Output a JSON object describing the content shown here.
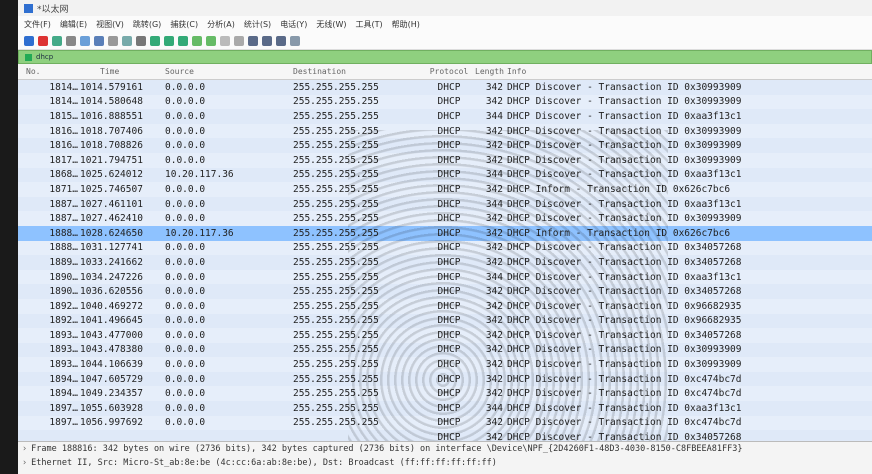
{
  "window": {
    "title": "*以太网"
  },
  "menu": [
    "文件(F)",
    "编辑(E)",
    "视图(V)",
    "跳转(G)",
    "捕获(C)",
    "分析(A)",
    "统计(S)",
    "电话(Y)",
    "无线(W)",
    "工具(T)",
    "帮助(H)"
  ],
  "filter": {
    "text": "dhcp"
  },
  "columns": {
    "no": "No.",
    "time": "Time",
    "src": "Source",
    "dst": "Destination",
    "proto": "Protocol",
    "len": "Length",
    "info": "Info"
  },
  "packets": [
    {
      "no": "1814…",
      "time": "1014.579161",
      "src": "0.0.0.0",
      "dst": "255.255.255.255",
      "proto": "DHCP",
      "len": "342",
      "info": "DHCP Discover  - Transaction ID 0x30993909"
    },
    {
      "no": "1814…",
      "time": "1014.580648",
      "src": "0.0.0.0",
      "dst": "255.255.255.255",
      "proto": "DHCP",
      "len": "342",
      "info": "DHCP Discover  - Transaction ID 0x30993909"
    },
    {
      "no": "1815…",
      "time": "1016.888551",
      "src": "0.0.0.0",
      "dst": "255.255.255.255",
      "proto": "DHCP",
      "len": "344",
      "info": "DHCP Discover  - Transaction ID 0xaa3f13c1"
    },
    {
      "no": "1816…",
      "time": "1018.707406",
      "src": "0.0.0.0",
      "dst": "255.255.255.255",
      "proto": "DHCP",
      "len": "342",
      "info": "DHCP Discover  - Transaction ID 0x30993909"
    },
    {
      "no": "1816…",
      "time": "1018.708826",
      "src": "0.0.0.0",
      "dst": "255.255.255.255",
      "proto": "DHCP",
      "len": "342",
      "info": "DHCP Discover  - Transaction ID 0x30993909"
    },
    {
      "no": "1817…",
      "time": "1021.794751",
      "src": "0.0.0.0",
      "dst": "255.255.255.255",
      "proto": "DHCP",
      "len": "342",
      "info": "DHCP Discover  - Transaction ID 0x30993909"
    },
    {
      "no": "1868…",
      "time": "1025.624012",
      "src": "10.20.117.36",
      "dst": "255.255.255.255",
      "proto": "DHCP",
      "len": "344",
      "info": "DHCP Discover  - Transaction ID 0xaa3f13c1"
    },
    {
      "no": "1871…",
      "time": "1025.746507",
      "src": "0.0.0.0",
      "dst": "255.255.255.255",
      "proto": "DHCP",
      "len": "342",
      "info": "DHCP Inform    - Transaction ID 0x626c7bc6"
    },
    {
      "no": "1887…",
      "time": "1027.461101",
      "src": "0.0.0.0",
      "dst": "255.255.255.255",
      "proto": "DHCP",
      "len": "344",
      "info": "DHCP Discover  - Transaction ID 0xaa3f13c1"
    },
    {
      "no": "1887…",
      "time": "1027.462410",
      "src": "0.0.0.0",
      "dst": "255.255.255.255",
      "proto": "DHCP",
      "len": "342",
      "info": "DHCP Discover  - Transaction ID 0x30993909"
    },
    {
      "no": "1888…",
      "time": "1028.624650",
      "src": "10.20.117.36",
      "dst": "255.255.255.255",
      "proto": "DHCP",
      "len": "342",
      "info": "DHCP Inform    - Transaction ID 0x626c7bc6",
      "selected": true
    },
    {
      "no": "1888…",
      "time": "1031.127741",
      "src": "0.0.0.0",
      "dst": "255.255.255.255",
      "proto": "DHCP",
      "len": "342",
      "info": "DHCP Discover  - Transaction ID 0x34057268"
    },
    {
      "no": "1889…",
      "time": "1033.241662",
      "src": "0.0.0.0",
      "dst": "255.255.255.255",
      "proto": "DHCP",
      "len": "342",
      "info": "DHCP Discover  - Transaction ID 0x34057268"
    },
    {
      "no": "1890…",
      "time": "1034.247226",
      "src": "0.0.0.0",
      "dst": "255.255.255.255",
      "proto": "DHCP",
      "len": "344",
      "info": "DHCP Discover  - Transaction ID 0xaa3f13c1"
    },
    {
      "no": "1890…",
      "time": "1036.620556",
      "src": "0.0.0.0",
      "dst": "255.255.255.255",
      "proto": "DHCP",
      "len": "342",
      "info": "DHCP Discover  - Transaction ID 0x34057268"
    },
    {
      "no": "1892…",
      "time": "1040.469272",
      "src": "0.0.0.0",
      "dst": "255.255.255.255",
      "proto": "DHCP",
      "len": "342",
      "info": "DHCP Discover  - Transaction ID 0x96682935"
    },
    {
      "no": "1892…",
      "time": "1041.496645",
      "src": "0.0.0.0",
      "dst": "255.255.255.255",
      "proto": "DHCP",
      "len": "342",
      "info": "DHCP Discover  - Transaction ID 0x96682935"
    },
    {
      "no": "1893…",
      "time": "1043.477000",
      "src": "0.0.0.0",
      "dst": "255.255.255.255",
      "proto": "DHCP",
      "len": "342",
      "info": "DHCP Discover  - Transaction ID 0x34057268"
    },
    {
      "no": "1893…",
      "time": "1043.478380",
      "src": "0.0.0.0",
      "dst": "255.255.255.255",
      "proto": "DHCP",
      "len": "342",
      "info": "DHCP Discover  - Transaction ID 0x30993909"
    },
    {
      "no": "1893…",
      "time": "1044.106639",
      "src": "0.0.0.0",
      "dst": "255.255.255.255",
      "proto": "DHCP",
      "len": "342",
      "info": "DHCP Discover  - Transaction ID 0x30993909"
    },
    {
      "no": "1894…",
      "time": "1047.605729",
      "src": "0.0.0.0",
      "dst": "255.255.255.255",
      "proto": "DHCP",
      "len": "342",
      "info": "DHCP Discover  - Transaction ID 0xc474bc7d"
    },
    {
      "no": "1894…",
      "time": "1049.234357",
      "src": "0.0.0.0",
      "dst": "255.255.255.255",
      "proto": "DHCP",
      "len": "342",
      "info": "DHCP Discover  - Transaction ID 0xc474bc7d"
    },
    {
      "no": "1897…",
      "time": "1055.603928",
      "src": "0.0.0.0",
      "dst": "255.255.255.255",
      "proto": "DHCP",
      "len": "344",
      "info": "DHCP Discover  - Transaction ID 0xaa3f13c1"
    },
    {
      "no": "1897…",
      "time": "1056.997692",
      "src": "0.0.0.0",
      "dst": "255.255.255.255",
      "proto": "DHCP",
      "len": "342",
      "info": "DHCP Discover  - Transaction ID 0xc474bc7d"
    },
    {
      "no": "",
      "time": "",
      "src": "",
      "dst": "",
      "proto": "DHCP",
      "len": "342",
      "info": "DHCP Discover  - Transaction ID 0x34057268"
    }
  ],
  "details": [
    "Frame 188816: 342 bytes on wire (2736 bits), 342 bytes captured (2736 bits) on interface \\Device\\NPF_{2D4260F1-48D3-4030-8150-C8FBEEA81FF3}",
    "Ethernet II, Src: Micro-St_ab:8e:be (4c:cc:6a:ab:8e:be), Dst: Broadcast (ff:ff:ff:ff:ff:ff)"
  ],
  "colors": {
    "row": "#dfe9f8",
    "selected": "#8ec2ff",
    "filter": "#8fd07f"
  }
}
